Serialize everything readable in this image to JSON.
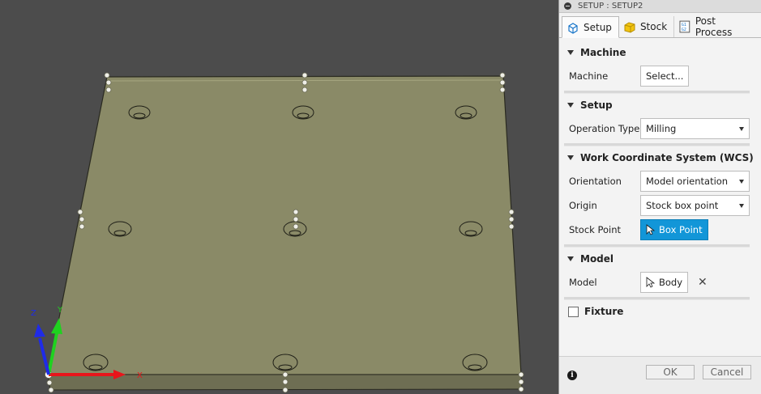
{
  "panel": {
    "title": "SETUP : SETUP2",
    "tabs": [
      {
        "label": "Setup",
        "active": true
      },
      {
        "label": "Stock",
        "active": false
      },
      {
        "label": "Post Process",
        "active": false
      }
    ],
    "sections": {
      "machine": {
        "title": "Machine",
        "machine_label": "Machine",
        "machine_button": "Select..."
      },
      "setup": {
        "title": "Setup",
        "operation_type_label": "Operation Type",
        "operation_type_value": "Milling"
      },
      "wcs": {
        "title": "Work Coordinate System (WCS)",
        "orientation_label": "Orientation",
        "orientation_value": "Model orientation",
        "origin_label": "Origin",
        "origin_value": "Stock box point",
        "stock_point_label": "Stock Point",
        "stock_point_button": "Box Point"
      },
      "model": {
        "title": "Model",
        "model_label": "Model",
        "model_button": "Body"
      },
      "fixture": {
        "label": "Fixture",
        "checked": false
      }
    },
    "footer": {
      "ok_label": "OK",
      "cancel_label": "Cancel"
    }
  },
  "viewport": {
    "axis_labels": {
      "x": "X",
      "y": "Y",
      "z": "Z"
    },
    "colors": {
      "background": "#4c4c4c",
      "plate_top": "#8a8a67",
      "plate_side": "#6e6e53",
      "axis_x": "#e8151b",
      "axis_y": "#1fd21f",
      "axis_z": "#1f2be8",
      "accent": "#1296d8"
    }
  }
}
